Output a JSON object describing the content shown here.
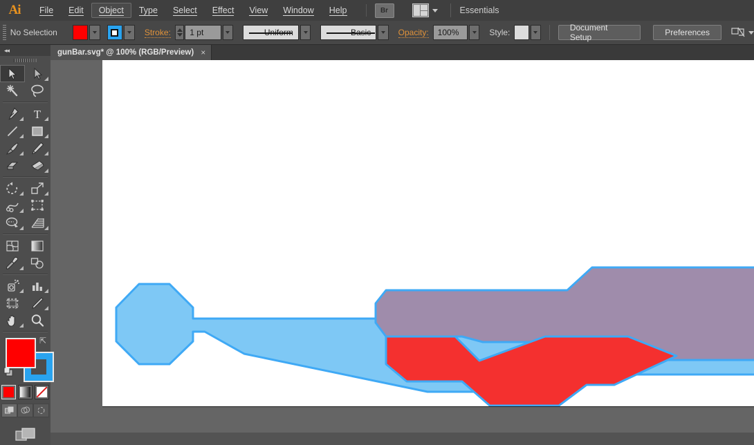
{
  "app": {
    "logo": "Ai",
    "workspace": "Essentials",
    "bridge_label": "Br"
  },
  "menubar": {
    "items": [
      {
        "label": "File",
        "mnemonic": 0,
        "active": false
      },
      {
        "label": "Edit",
        "mnemonic": 0,
        "active": false
      },
      {
        "label": "Object",
        "mnemonic": 0,
        "active": true
      },
      {
        "label": "Type",
        "mnemonic": 0,
        "active": false
      },
      {
        "label": "Select",
        "mnemonic": 0,
        "active": false
      },
      {
        "label": "Effect",
        "mnemonic": 4,
        "active": false
      },
      {
        "label": "View",
        "mnemonic": 0,
        "active": false
      },
      {
        "label": "Window",
        "mnemonic": 0,
        "active": false
      },
      {
        "label": "Help",
        "mnemonic": 0,
        "active": false
      }
    ]
  },
  "controlbar": {
    "selection_status": "No Selection",
    "fill_color": "#ff0000",
    "stroke_color": "#29a3ef",
    "stroke_label": "Stroke:",
    "stroke_weight": "1 pt",
    "profile_label": "Uniform",
    "brush_label": "Basic",
    "opacity_label": "Opacity:",
    "opacity_value": "100%",
    "style_label": "Style:",
    "document_setup_label": "Document Setup",
    "preferences_label": "Preferences"
  },
  "tabbar": {
    "tab_title": "gunBar.svg* @ 100% (RGB/Preview)",
    "close_glyph": "×"
  },
  "toolpanel": {
    "collapse_glyph": "◂◂",
    "tools": [
      {
        "name": "selection-tool",
        "selected": true,
        "flyout": false
      },
      {
        "name": "direct-selection-tool",
        "selected": false,
        "flyout": true
      },
      {
        "name": "magic-wand-tool",
        "selected": false,
        "flyout": false
      },
      {
        "name": "lasso-tool",
        "selected": false,
        "flyout": false
      },
      {
        "name": "pen-tool",
        "selected": false,
        "flyout": true
      },
      {
        "name": "type-tool",
        "selected": false,
        "flyout": true
      },
      {
        "name": "line-segment-tool",
        "selected": false,
        "flyout": true
      },
      {
        "name": "rectangle-tool",
        "selected": false,
        "flyout": true
      },
      {
        "name": "paintbrush-tool",
        "selected": false,
        "flyout": true
      },
      {
        "name": "pencil-tool",
        "selected": false,
        "flyout": true
      },
      {
        "name": "blob-brush-tool",
        "selected": false,
        "flyout": false
      },
      {
        "name": "eraser-tool",
        "selected": false,
        "flyout": true
      },
      {
        "name": "rotate-tool",
        "selected": false,
        "flyout": true
      },
      {
        "name": "scale-tool",
        "selected": false,
        "flyout": true
      },
      {
        "name": "width-tool",
        "selected": false,
        "flyout": true
      },
      {
        "name": "free-transform-tool",
        "selected": false,
        "flyout": false
      },
      {
        "name": "shape-builder-tool",
        "selected": false,
        "flyout": true
      },
      {
        "name": "perspective-grid-tool",
        "selected": false,
        "flyout": true
      },
      {
        "name": "mesh-tool",
        "selected": false,
        "flyout": false
      },
      {
        "name": "gradient-tool",
        "selected": false,
        "flyout": false
      },
      {
        "name": "eyedropper-tool",
        "selected": false,
        "flyout": true
      },
      {
        "name": "blend-tool",
        "selected": false,
        "flyout": false
      },
      {
        "name": "symbol-sprayer-tool",
        "selected": false,
        "flyout": true
      },
      {
        "name": "column-graph-tool",
        "selected": false,
        "flyout": true
      },
      {
        "name": "artboard-tool",
        "selected": false,
        "flyout": false
      },
      {
        "name": "slice-tool",
        "selected": false,
        "flyout": true
      },
      {
        "name": "hand-tool",
        "selected": false,
        "flyout": true
      },
      {
        "name": "zoom-tool",
        "selected": false,
        "flyout": false
      }
    ],
    "fill_color": "#ff0000",
    "stroke_color": "#29a3ef",
    "color_modes": [
      {
        "name": "color-mode-color",
        "active": true
      },
      {
        "name": "color-mode-gradient",
        "active": false
      },
      {
        "name": "color-mode-none",
        "active": false
      }
    ],
    "drawing_modes": [
      {
        "name": "draw-normal-mode",
        "active": true
      },
      {
        "name": "draw-behind-mode",
        "active": false
      },
      {
        "name": "draw-inside-mode",
        "active": false
      }
    ],
    "screen_mode": "change-screen-mode"
  },
  "artwork": {
    "artboard_background": "#ffffff",
    "stroke_color": "#3fa9f5",
    "shapes": [
      {
        "name": "gun-body-outline",
        "fill": "#7ec8f5",
        "stroke": "#3fa9f5",
        "stroke_width": 3,
        "points": "20 358, 53 324, 97 324, 131 358, 131 374, 148 374, 884 374, 920 340, 960 305, 1050 305, 1080 330, 1080 430, 1050 455, 700 455, 660 490, 625 490, 610 480, 470 480, 205 425, 148 393, 131 393, 131 407, 97 440, 53 440, 20 407"
      },
      {
        "name": "gun-barrel-purple-shape",
        "fill": "#9f8cab",
        "stroke": "#3fa9f5",
        "stroke_width": 3,
        "points": "410 333, 672 333, 708 300, 960 300, 1060 300, 1090 328, 1090 406, 1058 434, 735 434, 700 408, 550 408, 520 400, 410 400, 395 380, 395 352"
      },
      {
        "name": "gun-magazine-red-shape",
        "fill": "#f4302f",
        "stroke": "#3fa9f5",
        "stroke_width": 3,
        "points": "410 400, 510 400, 545 435, 640 400, 760 400, 830 428, 740 470, 700 470, 660 500, 560 500, 520 465, 440 465, 410 440"
      }
    ]
  }
}
